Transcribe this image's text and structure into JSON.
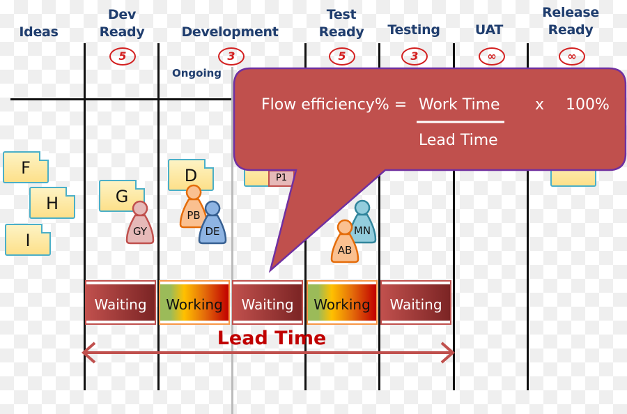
{
  "columns": [
    {
      "title": "Ideas",
      "wip": ""
    },
    {
      "title": "Dev Ready",
      "wip": "5"
    },
    {
      "title": "Development",
      "wip": "3",
      "sub": "Ongoing"
    },
    {
      "title": "Test Ready",
      "wip": "5"
    },
    {
      "title": "Testing",
      "wip": "3"
    },
    {
      "title": "UAT",
      "wip": "∞"
    },
    {
      "title": "Release Ready",
      "wip": "∞"
    }
  ],
  "cards": [
    "F",
    "H",
    "I",
    "G",
    "D"
  ],
  "tag": "P1",
  "people": [
    "GY",
    "PB",
    "DE",
    "MN",
    "AB"
  ],
  "callout": {
    "lhs": "Flow efficiency% =",
    "numerator": "Work Time",
    "denominator": "Lead Time",
    "times": "x",
    "factor": "100%"
  },
  "stages": [
    "Waiting",
    "Working",
    "Waiting",
    "Working",
    "Waiting"
  ],
  "lead_time": "Lead Time",
  "colors": {
    "header": "#1f3d6e",
    "wip": "#d32020",
    "callout": "#c0504d",
    "callout_border": "#7030a0",
    "waiting": "#c0504d",
    "lead_time": "#c00000"
  }
}
